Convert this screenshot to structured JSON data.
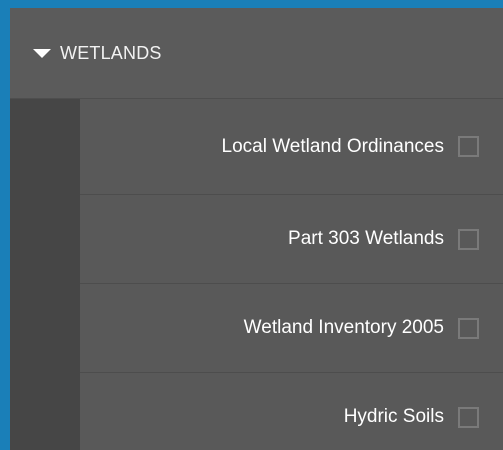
{
  "panel": {
    "header": {
      "title": "WETLANDS",
      "caret_icon": "caret-down-icon",
      "expanded": true
    },
    "layers": [
      {
        "label": "Local Wetland Ordinances",
        "checked": false
      },
      {
        "label": "Part 303 Wetlands",
        "checked": false
      },
      {
        "label": "Wetland Inventory 2005",
        "checked": false
      },
      {
        "label": "Hydric Soils",
        "checked": false
      }
    ]
  },
  "colors": {
    "background": "#1a7fb8",
    "panel": "#575757",
    "left_strip": "#464646",
    "text": "#ffffff"
  }
}
